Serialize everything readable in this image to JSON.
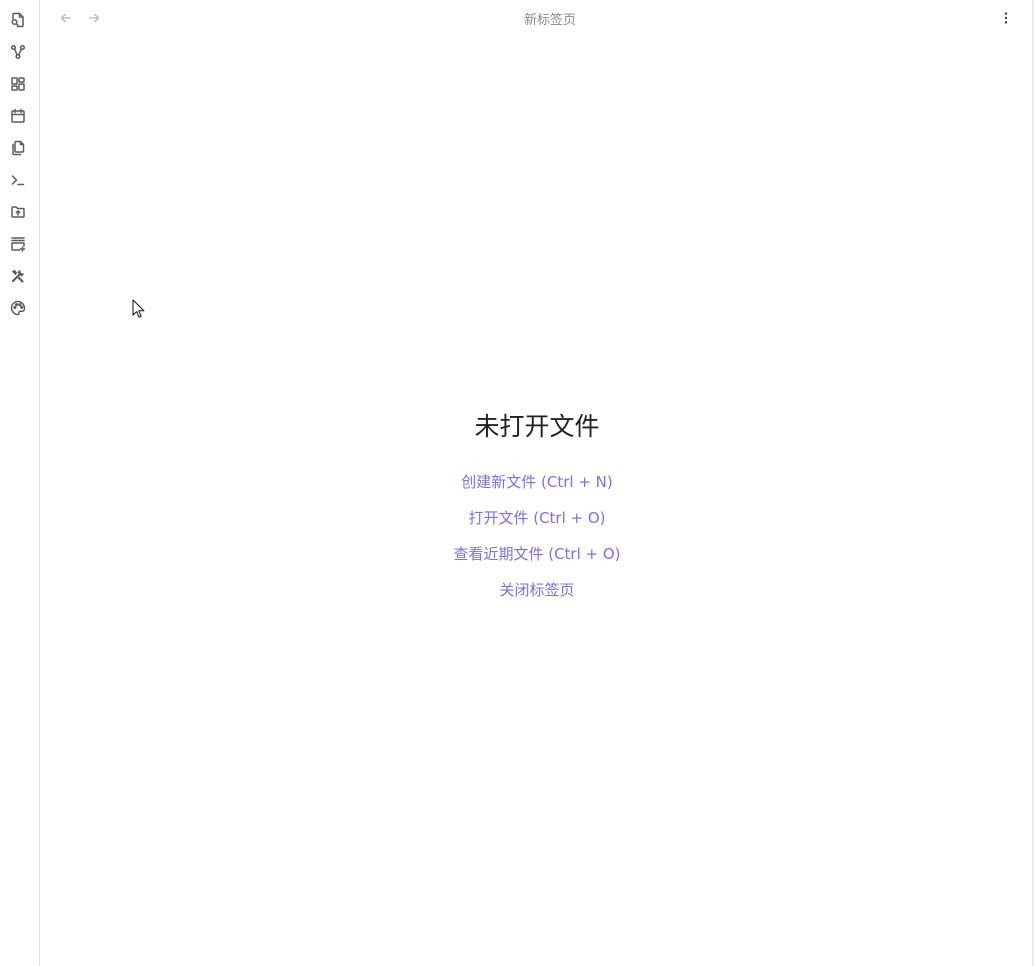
{
  "ribbon": {
    "items": [
      {
        "name": "quick-switcher",
        "icon": "file-search-icon"
      },
      {
        "name": "graph-view",
        "icon": "git-fork-icon"
      },
      {
        "name": "canvas",
        "icon": "layout-dashboard-icon"
      },
      {
        "name": "daily-note",
        "icon": "calendar-icon"
      },
      {
        "name": "templates",
        "icon": "files-icon"
      },
      {
        "name": "command-palette",
        "icon": "terminal-icon"
      },
      {
        "name": "publish",
        "icon": "folder-up-icon"
      },
      {
        "name": "new-canvas",
        "icon": "panel-plus-icon"
      },
      {
        "name": "plugins",
        "icon": "tools-icon"
      },
      {
        "name": "theme",
        "icon": "palette-icon"
      }
    ]
  },
  "header": {
    "tab_title": "新标签页",
    "back_icon": "arrow-left-icon",
    "forward_icon": "arrow-right-icon",
    "more_icon": "more-vertical-icon"
  },
  "empty_state": {
    "title": "未打开文件",
    "actions": [
      "创建新文件 (Ctrl + N)",
      "打开文件 (Ctrl + O)",
      "查看近期文件 (Ctrl + O)",
      "关闭标签页"
    ]
  },
  "colors": {
    "accent": "#7f6df2",
    "title": "#222222",
    "muted": "#8a8a8a",
    "icon": "#5c5c5c"
  }
}
